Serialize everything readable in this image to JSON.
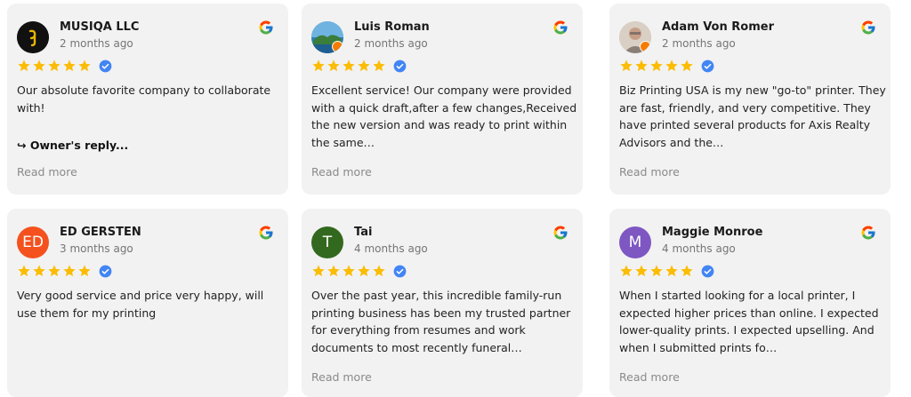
{
  "reviews": [
    {
      "name": "MUSIQA LLC",
      "date": "2 months ago",
      "avatar_type": "logo",
      "avatar_text": "",
      "avatar_color": "#111111",
      "text": "Our absolute favorite company to collaborate with!",
      "owner_reply": "↪ Owner's reply...",
      "read_more": "Read more"
    },
    {
      "name": "Luis Roman",
      "date": "2 months ago",
      "avatar_type": "photo-landscape",
      "avatar_text": "",
      "avatar_color": "#4a90c8",
      "text": "Excellent service! Our company were provided with a quick draft,after a few changes,Received the new version and was ready to print within the same…",
      "owner_reply": "",
      "read_more": "Read more"
    },
    {
      "name": "Adam Von Romer",
      "date": "2 months ago",
      "avatar_type": "photo-person",
      "avatar_text": "",
      "avatar_color": "#c9b8a8",
      "text": "Biz Printing USA is my new \"go-to\" printer. They are fast, friendly, and very competitive. They have printed several products for Axis Realty Advisors and the…",
      "owner_reply": "",
      "read_more": "Read more"
    },
    {
      "name": "ED GERSTEN",
      "date": "3 months ago",
      "avatar_type": "letter",
      "avatar_text": "ED",
      "avatar_color": "#f4511e",
      "text": "Very good service and price very happy, will use them for my printing",
      "owner_reply": "",
      "read_more": ""
    },
    {
      "name": "Tai",
      "date": "4 months ago",
      "avatar_type": "letter",
      "avatar_text": "T",
      "avatar_color": "#33691e",
      "text": "Over the past year, this incredible family-run printing business has been my trusted partner for everything from resumes and work documents to most recently funeral…",
      "owner_reply": "",
      "read_more": "Read more"
    },
    {
      "name": "Maggie Monroe",
      "date": "4 months ago",
      "avatar_type": "letter",
      "avatar_text": "M",
      "avatar_color": "#7e57c2",
      "text": "When I started looking for a local printer, I expected higher prices than online. I expected lower-quality prints. I expected upselling. And when I submitted prints fo…",
      "owner_reply": "",
      "read_more": "Read more"
    }
  ],
  "rating": {
    "stars": 5,
    "max": 5
  },
  "colors": {
    "star": "#fbbc04",
    "verified": "#4285f4",
    "card_bg": "#f2f2f2"
  }
}
